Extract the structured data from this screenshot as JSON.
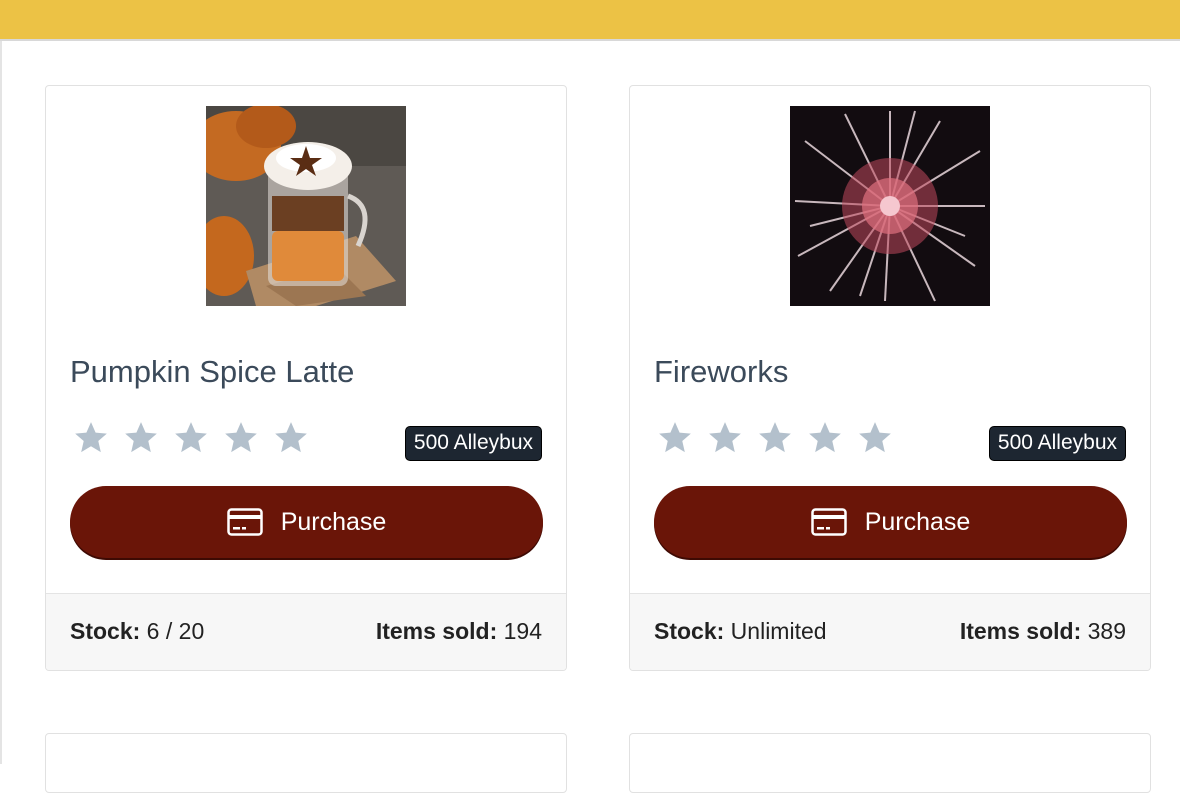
{
  "colors": {
    "header": "#ecc245",
    "purchase_button": "#6a1508",
    "price_badge": "#1d2631",
    "star": "#b3c0cc",
    "title_text": "#3b4a5a"
  },
  "products": [
    {
      "image": "pumpkin-spice-latte-photo",
      "title": "Pumpkin Spice Latte",
      "rating": 0,
      "rating_max": 5,
      "price": "500 Alleybux",
      "purchase_icon": "credit-card-icon",
      "purchase_label": "Purchase",
      "stock_label": "Stock:",
      "stock_value": " 6 / 20",
      "sold_label": "Items sold:",
      "sold_value": " 194"
    },
    {
      "image": "fireworks-photo",
      "title": "Fireworks",
      "rating": 0,
      "rating_max": 5,
      "price": "500 Alleybux",
      "purchase_icon": "credit-card-icon",
      "purchase_label": "Purchase",
      "stock_label": "Stock:",
      "stock_value": " Unlimited",
      "sold_label": "Items sold:",
      "sold_value": " 389"
    }
  ]
}
